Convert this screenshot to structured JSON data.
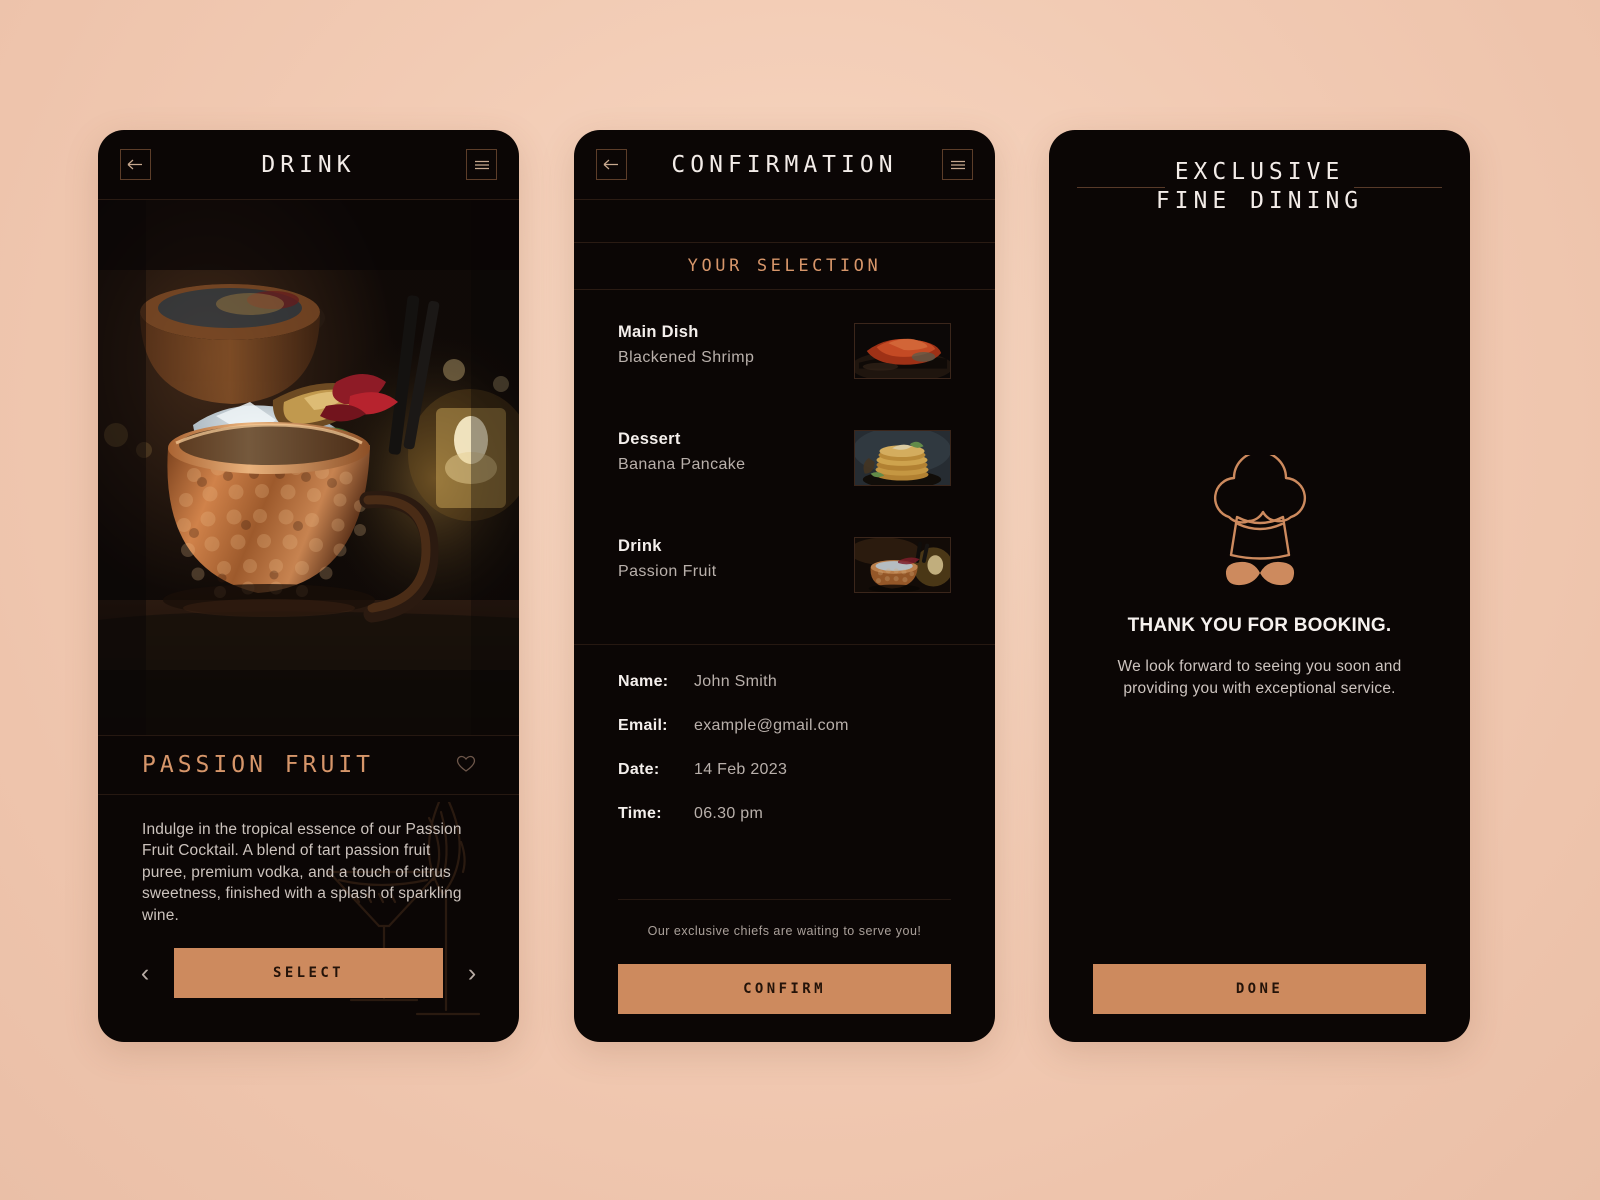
{
  "theme": {
    "background": "#f2cbb4",
    "phone_bg": "#0b0605",
    "accent": "#cd8a5e",
    "accent_text": "#d7966a",
    "text_primary": "#f4efec",
    "text_secondary": "#b9b0ab"
  },
  "drink_screen": {
    "title": "DRINK",
    "back_icon": "arrow-left-icon",
    "menu_icon": "hamburger-menu-icon",
    "hero_image_alt": "Copper Moscow mule mug with ice, passion fruit and rose petal garnish, black straws, warm candle bokeh",
    "item_name": "PASSION FRUIT",
    "favorite_icon": "heart-icon",
    "description": "Indulge in the tropical essence of our Passion Fruit Cocktail. A blend of tart passion fruit puree, premium vodka, and a touch of citrus sweetness, finished with a splash of sparkling wine.",
    "prev_icon": "chevron-left-icon",
    "next_icon": "chevron-right-icon",
    "select_label": "SELECT"
  },
  "confirmation_screen": {
    "title": "CONFIRMATION",
    "back_icon": "arrow-left-icon",
    "menu_icon": "hamburger-menu-icon",
    "section_heading": "YOUR SELECTION",
    "selections": [
      {
        "label": "Main Dish",
        "value": "Blackened Shrimp",
        "thumb": "blackened-shrimp-thumbnail"
      },
      {
        "label": "Dessert",
        "value": "Banana Pancake",
        "thumb": "banana-pancake-thumbnail"
      },
      {
        "label": "Drink",
        "value": "Passion Fruit",
        "thumb": "passion-fruit-drink-thumbnail"
      }
    ],
    "details": [
      {
        "key": "Name:",
        "value": "John Smith"
      },
      {
        "key": "Email:",
        "value": "example@gmail.com"
      },
      {
        "key": "Date:",
        "value": "14 Feb 2023"
      },
      {
        "key": "Time:",
        "value": "06.30 pm"
      }
    ],
    "footer_note": "Our exclusive chiefs are waiting to serve you!",
    "confirm_label": "CONFIRM"
  },
  "thanks_screen": {
    "brand_line_1": "EXCLUSIVE",
    "brand_line_2": "FINE DINING",
    "logo_icon": "chef-hat-mustache-icon",
    "thanks_title": "THANK YOU FOR BOOKING.",
    "thanks_subtitle": "We look forward to seeing you soon and providing you with exceptional service.",
    "done_label": "DONE"
  }
}
